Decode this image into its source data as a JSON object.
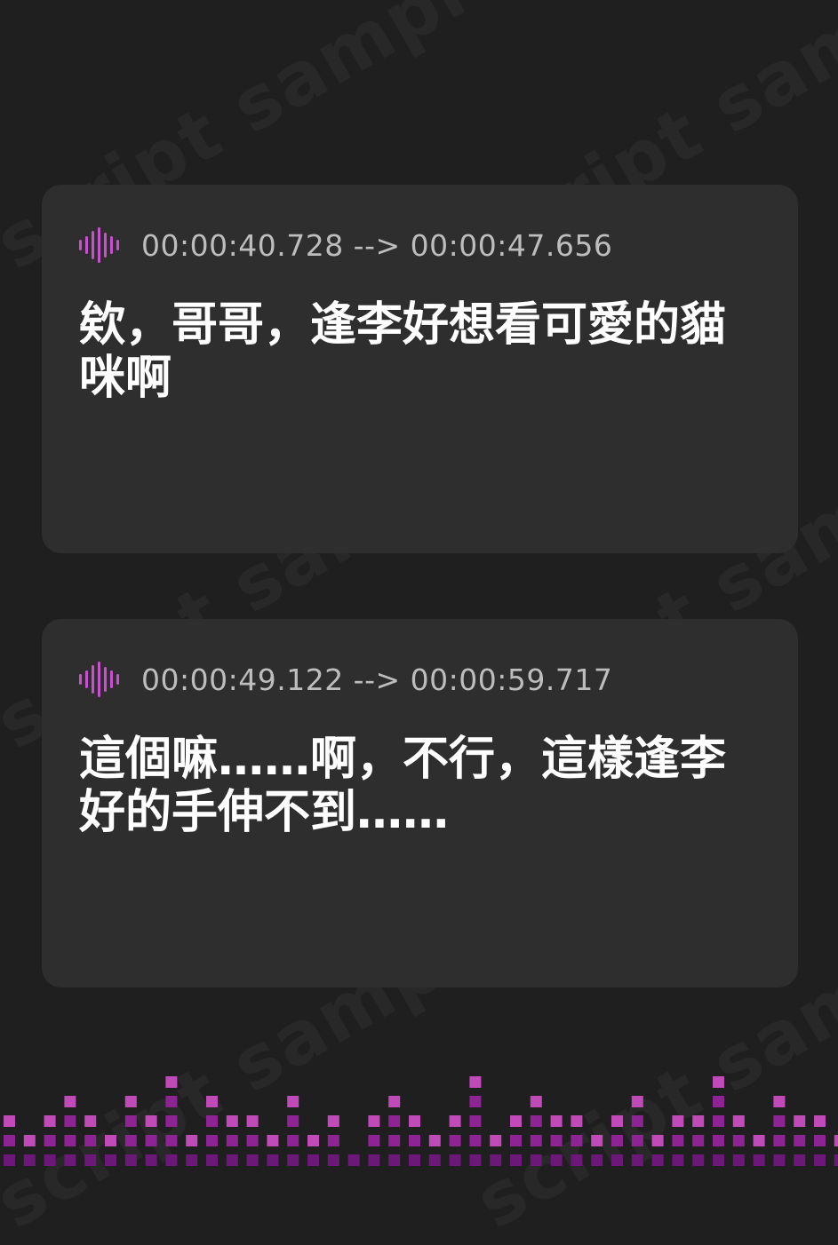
{
  "watermark_text": "script sample",
  "accent_color": "#c94fd0",
  "cues": [
    {
      "icon": "audio-waveform-icon",
      "timestamp": "00:00:40.728 --> 00:00:47.656",
      "text": "欸，哥哥，逢李好想看可愛的貓咪啊"
    },
    {
      "icon": "audio-waveform-icon",
      "timestamp": "00:00:49.122 --> 00:00:59.717",
      "text": "這個嘛……啊，不行，這樣逢李好的手伸不到……"
    }
  ],
  "equalizer": {
    "icon": "equalizer-bars-decoration",
    "colors": {
      "low": "#6b1878",
      "mid": "#8e2494",
      "high": "#c04bb8"
    },
    "levels": [
      2,
      1,
      2,
      3,
      2,
      1,
      3,
      2,
      4,
      1,
      3,
      2,
      2,
      1,
      3,
      1,
      2,
      0,
      2,
      3,
      2,
      1,
      2,
      4,
      1,
      2,
      3,
      2,
      2,
      1,
      2,
      3,
      1,
      2,
      2,
      4,
      2,
      1,
      3,
      2,
      2,
      1,
      2,
      2
    ]
  }
}
